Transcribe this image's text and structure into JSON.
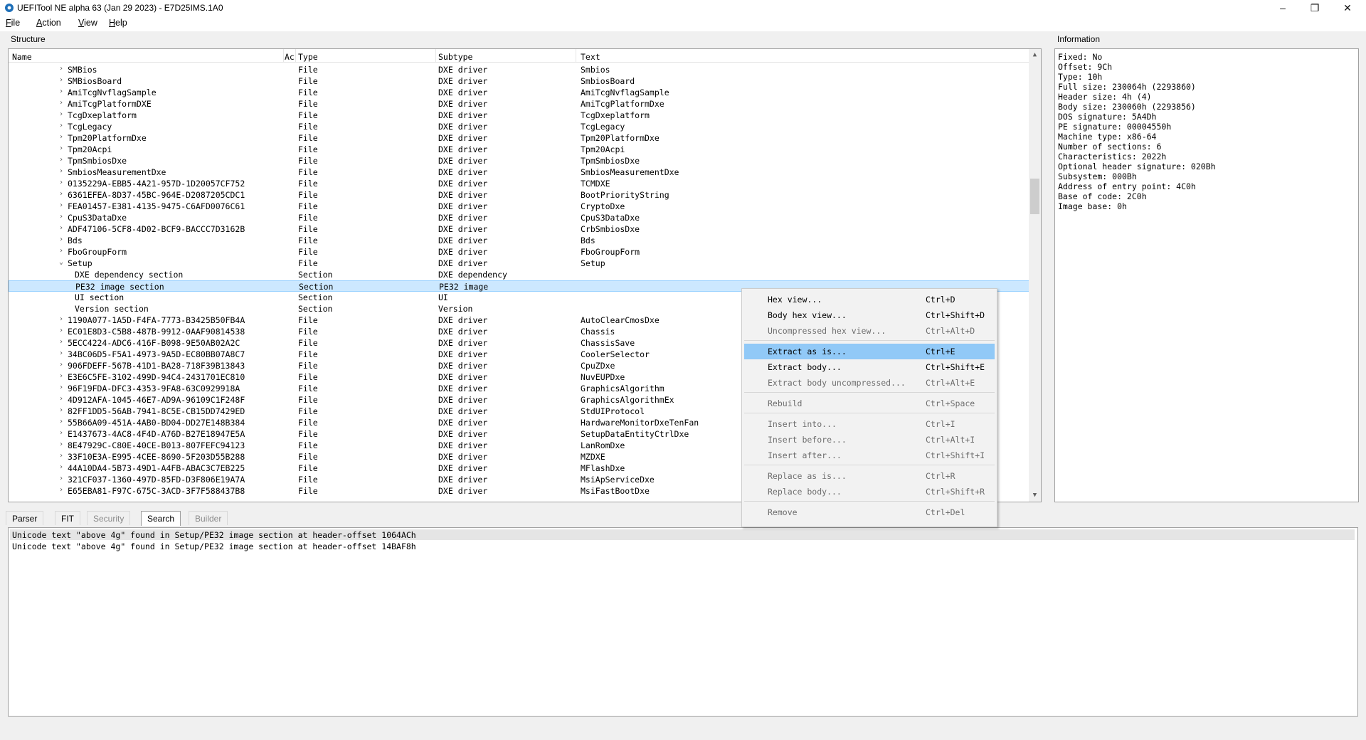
{
  "window": {
    "title": "UEFITool NE alpha 63 (Jan 29 2023) - E7D25IMS.1A0"
  },
  "menu": [
    {
      "key": "F",
      "rest": "ile"
    },
    {
      "key": "A",
      "rest": "ction"
    },
    {
      "key": "V",
      "rest": "iew"
    },
    {
      "key": "H",
      "rest": "elp"
    }
  ],
  "structure": {
    "label": "Structure",
    "columns": [
      "Name",
      "Ac",
      "Type",
      "Subtype",
      "Text"
    ],
    "rows": [
      {
        "name": "SMBios",
        "type": "File",
        "subtype": "DXE driver",
        "text": "Smbios",
        "level": 1,
        "exp": "›"
      },
      {
        "name": "SMBiosBoard",
        "type": "File",
        "subtype": "DXE driver",
        "text": "SmbiosBoard",
        "level": 1,
        "exp": "›"
      },
      {
        "name": "AmiTcgNvflagSample",
        "type": "File",
        "subtype": "DXE driver",
        "text": "AmiTcgNvflagSample",
        "level": 1,
        "exp": "›"
      },
      {
        "name": "AmiTcgPlatformDXE",
        "type": "File",
        "subtype": "DXE driver",
        "text": "AmiTcgPlatformDxe",
        "level": 1,
        "exp": "›"
      },
      {
        "name": "TcgDxeplatform",
        "type": "File",
        "subtype": "DXE driver",
        "text": "TcgDxeplatform",
        "level": 1,
        "exp": "›"
      },
      {
        "name": "TcgLegacy",
        "type": "File",
        "subtype": "DXE driver",
        "text": "TcgLegacy",
        "level": 1,
        "exp": "›"
      },
      {
        "name": "Tpm20PlatformDxe",
        "type": "File",
        "subtype": "DXE driver",
        "text": "Tpm20PlatformDxe",
        "level": 1,
        "exp": "›"
      },
      {
        "name": "Tpm20Acpi",
        "type": "File",
        "subtype": "DXE driver",
        "text": "Tpm20Acpi",
        "level": 1,
        "exp": "›"
      },
      {
        "name": "TpmSmbiosDxe",
        "type": "File",
        "subtype": "DXE driver",
        "text": "TpmSmbiosDxe",
        "level": 1,
        "exp": "›"
      },
      {
        "name": "SmbiosMeasurementDxe",
        "type": "File",
        "subtype": "DXE driver",
        "text": "SmbiosMeasurementDxe",
        "level": 1,
        "exp": "›"
      },
      {
        "name": "0135229A-EBB5-4A21-957D-1D20057CF752",
        "type": "File",
        "subtype": "DXE driver",
        "text": "TCMDXE",
        "level": 1,
        "exp": "›"
      },
      {
        "name": "6361EFEA-8D37-45BC-964E-D2087205CDC1",
        "type": "File",
        "subtype": "DXE driver",
        "text": "BootPriorityString",
        "level": 1,
        "exp": "›"
      },
      {
        "name": "FEA01457-E381-4135-9475-C6AFD0076C61",
        "type": "File",
        "subtype": "DXE driver",
        "text": "CryptoDxe",
        "level": 1,
        "exp": "›"
      },
      {
        "name": "CpuS3DataDxe",
        "type": "File",
        "subtype": "DXE driver",
        "text": "CpuS3DataDxe",
        "level": 1,
        "exp": "›"
      },
      {
        "name": "ADF47106-5CF8-4D02-BCF9-BACCC7D3162B",
        "type": "File",
        "subtype": "DXE driver",
        "text": "CrbSmbiosDxe",
        "level": 1,
        "exp": "›"
      },
      {
        "name": "Bds",
        "type": "File",
        "subtype": "DXE driver",
        "text": "Bds",
        "level": 1,
        "exp": "›"
      },
      {
        "name": "FboGroupForm",
        "type": "File",
        "subtype": "DXE driver",
        "text": "FboGroupForm",
        "level": 1,
        "exp": "›"
      },
      {
        "name": "Setup",
        "type": "File",
        "subtype": "DXE driver",
        "text": "Setup",
        "level": 1,
        "exp": "⌄"
      },
      {
        "name": "DXE dependency section",
        "type": "Section",
        "subtype": "DXE dependency",
        "text": "",
        "level": 2,
        "exp": ""
      },
      {
        "name": "PE32 image section",
        "type": "Section",
        "subtype": "PE32 image",
        "text": "",
        "level": 2,
        "exp": "",
        "selected": true
      },
      {
        "name": "UI section",
        "type": "Section",
        "subtype": "UI",
        "text": "",
        "level": 2,
        "exp": ""
      },
      {
        "name": "Version section",
        "type": "Section",
        "subtype": "Version",
        "text": "",
        "level": 2,
        "exp": ""
      },
      {
        "name": "1190A077-1A5D-F4FA-7773-B3425B50FB4A",
        "type": "File",
        "subtype": "DXE driver",
        "text": "AutoClearCmosDxe",
        "level": 1,
        "exp": "›"
      },
      {
        "name": "EC01E8D3-C5B8-487B-9912-0AAF90814538",
        "type": "File",
        "subtype": "DXE driver",
        "text": "Chassis",
        "level": 1,
        "exp": "›"
      },
      {
        "name": "5ECC4224-ADC6-416F-B098-9E50AB02A2C",
        "type": "File",
        "subtype": "DXE driver",
        "text": "ChassisSave",
        "level": 1,
        "exp": "›"
      },
      {
        "name": "34BC06D5-F5A1-4973-9A5D-EC80BB07A8C7",
        "type": "File",
        "subtype": "DXE driver",
        "text": "CoolerSelector",
        "level": 1,
        "exp": "›"
      },
      {
        "name": "906FDEFF-567B-41D1-BA28-718F39B13843",
        "type": "File",
        "subtype": "DXE driver",
        "text": "CpuZDxe",
        "level": 1,
        "exp": "›"
      },
      {
        "name": "E3E6C5FE-3102-499D-94C4-2431701EC810",
        "type": "File",
        "subtype": "DXE driver",
        "text": "NuvEUPDxe",
        "level": 1,
        "exp": "›"
      },
      {
        "name": "96F19FDA-DFC3-4353-9FA8-63C0929918A",
        "type": "File",
        "subtype": "DXE driver",
        "text": "GraphicsAlgorithm",
        "level": 1,
        "exp": "›"
      },
      {
        "name": "4D912AFA-1045-46E7-AD9A-96109C1F248F",
        "type": "File",
        "subtype": "DXE driver",
        "text": "GraphicsAlgorithmEx",
        "level": 1,
        "exp": "›"
      },
      {
        "name": "82FF1DD5-56AB-7941-8C5E-CB15DD7429ED",
        "type": "File",
        "subtype": "DXE driver",
        "text": "StdUIProtocol",
        "level": 1,
        "exp": "›"
      },
      {
        "name": "55B66A09-451A-4AB0-BD04-DD27E148B384",
        "type": "File",
        "subtype": "DXE driver",
        "text": "HardwareMonitorDxeTenFan",
        "level": 1,
        "exp": "›"
      },
      {
        "name": "E1437673-4AC8-4F4D-A76D-B27E18947E5A",
        "type": "File",
        "subtype": "DXE driver",
        "text": "SetupDataEntityCtrlDxe",
        "level": 1,
        "exp": "›"
      },
      {
        "name": "8E47929C-C80E-40CE-B013-807FEFC94123",
        "type": "File",
        "subtype": "DXE driver",
        "text": "LanRomDxe",
        "level": 1,
        "exp": "›"
      },
      {
        "name": "33F10E3A-E995-4CEE-8690-5F203D55B288",
        "type": "File",
        "subtype": "DXE driver",
        "text": "MZDXE",
        "level": 1,
        "exp": "›"
      },
      {
        "name": "44A10DA4-5B73-49D1-A4FB-ABAC3C7EB225",
        "type": "File",
        "subtype": "DXE driver",
        "text": "MFlashDxe",
        "level": 1,
        "exp": "›"
      },
      {
        "name": "321CF037-1360-497D-85FD-D3F806E19A7A",
        "type": "File",
        "subtype": "DXE driver",
        "text": "MsiApServiceDxe",
        "level": 1,
        "exp": "›"
      },
      {
        "name": "E65EBA81-F97C-675C-3ACD-3F7F588437B8",
        "type": "File",
        "subtype": "DXE driver",
        "text": "MsiFastBootDxe",
        "level": 1,
        "exp": "›"
      }
    ]
  },
  "information": {
    "label": "Information",
    "lines": [
      "Fixed: No",
      "Offset: 9Ch",
      "Type: 10h",
      "Full size: 230064h (2293860)",
      "Header size: 4h (4)",
      "Body size: 230060h (2293856)",
      "DOS signature: 5A4Dh",
      "PE signature: 00004550h",
      "Machine type: x86-64",
      "Number of sections: 6",
      "Characteristics: 2022h",
      "Optional header signature: 020Bh",
      "Subsystem: 000Bh",
      "Address of entry point: 4C0h",
      "Base of code: 2C0h",
      "Image base: 0h"
    ]
  },
  "tabs": [
    {
      "label": "Parser",
      "state": "normal"
    },
    {
      "label": "FIT",
      "state": "normal"
    },
    {
      "label": "Security",
      "state": "disabled"
    },
    {
      "label": "Search",
      "state": "active"
    },
    {
      "label": "Builder",
      "state": "disabled"
    }
  ],
  "results": [
    "Unicode text \"above 4g\" found in Setup/PE32 image section at header-offset 1064ACh",
    "Unicode text \"above 4g\" found in Setup/PE32 image section at header-offset 14BAF8h"
  ],
  "context_menu": {
    "groups": [
      [
        {
          "label": "Hex view...",
          "shortcut": "Ctrl+D",
          "enabled": true
        },
        {
          "label": "Body hex view...",
          "shortcut": "Ctrl+Shift+D",
          "enabled": true
        },
        {
          "label": "Uncompressed hex view...",
          "shortcut": "Ctrl+Alt+D",
          "enabled": false
        }
      ],
      [
        {
          "label": "Extract as is...",
          "shortcut": "Ctrl+E",
          "enabled": true,
          "highlight": true
        },
        {
          "label": "Extract body...",
          "shortcut": "Ctrl+Shift+E",
          "enabled": true
        },
        {
          "label": "Extract body uncompressed...",
          "shortcut": "Ctrl+Alt+E",
          "enabled": false
        }
      ],
      [
        {
          "label": "Rebuild",
          "shortcut": "Ctrl+Space",
          "enabled": false
        }
      ],
      [
        {
          "label": "Insert into...",
          "shortcut": "Ctrl+I",
          "enabled": false
        },
        {
          "label": "Insert before...",
          "shortcut": "Ctrl+Alt+I",
          "enabled": false
        },
        {
          "label": "Insert after...",
          "shortcut": "Ctrl+Shift+I",
          "enabled": false
        }
      ],
      [
        {
          "label": "Replace as is...",
          "shortcut": "Ctrl+R",
          "enabled": false
        },
        {
          "label": "Replace body...",
          "shortcut": "Ctrl+Shift+R",
          "enabled": false
        }
      ],
      [
        {
          "label": "Remove",
          "shortcut": "Ctrl+Del",
          "enabled": false
        }
      ]
    ]
  },
  "colors": {
    "selection": "#cce8ff",
    "menu_highlight": "#91c9f7",
    "disabled_text": "#6d6d6d"
  }
}
